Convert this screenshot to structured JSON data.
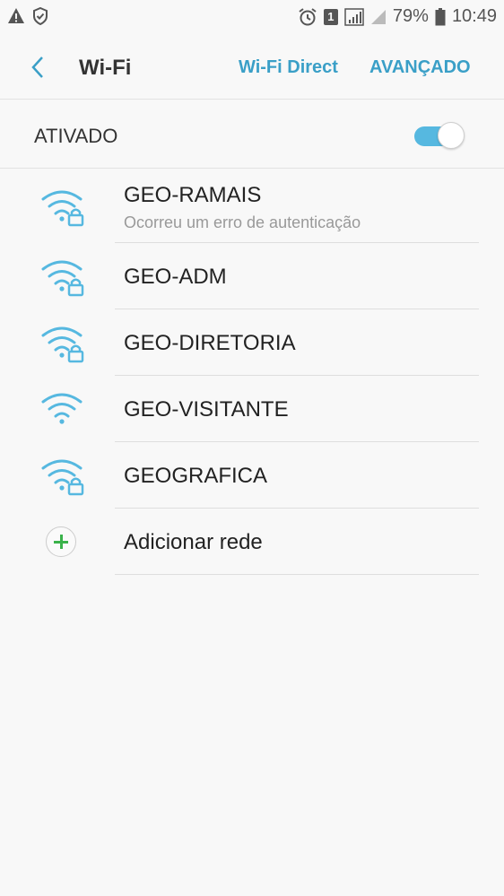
{
  "status_bar": {
    "sim_badge": "1",
    "battery": "79%",
    "time": "10:49"
  },
  "app_bar": {
    "title": "Wi-Fi",
    "wifi_direct": "Wi-Fi Direct",
    "advanced": "AVANÇADO"
  },
  "toggle": {
    "label": "ATIVADO",
    "on": true
  },
  "networks": [
    {
      "name": "GEO-RAMAIS",
      "subtitle": "Ocorreu um erro de autenticação",
      "locked": true
    },
    {
      "name": "GEO-ADM",
      "subtitle": "",
      "locked": true
    },
    {
      "name": "GEO-DIRETORIA",
      "subtitle": "",
      "locked": true
    },
    {
      "name": "GEO-VISITANTE",
      "subtitle": "",
      "locked": false
    },
    {
      "name": "GEOGRAFICA",
      "subtitle": "",
      "locked": true
    }
  ],
  "add_network": {
    "label": "Adicionar rede"
  },
  "colors": {
    "accent": "#3a9fc7",
    "wifi_icon": "#56b8e0",
    "add_plus": "#3ab24a",
    "background": "#f8f8f8"
  }
}
